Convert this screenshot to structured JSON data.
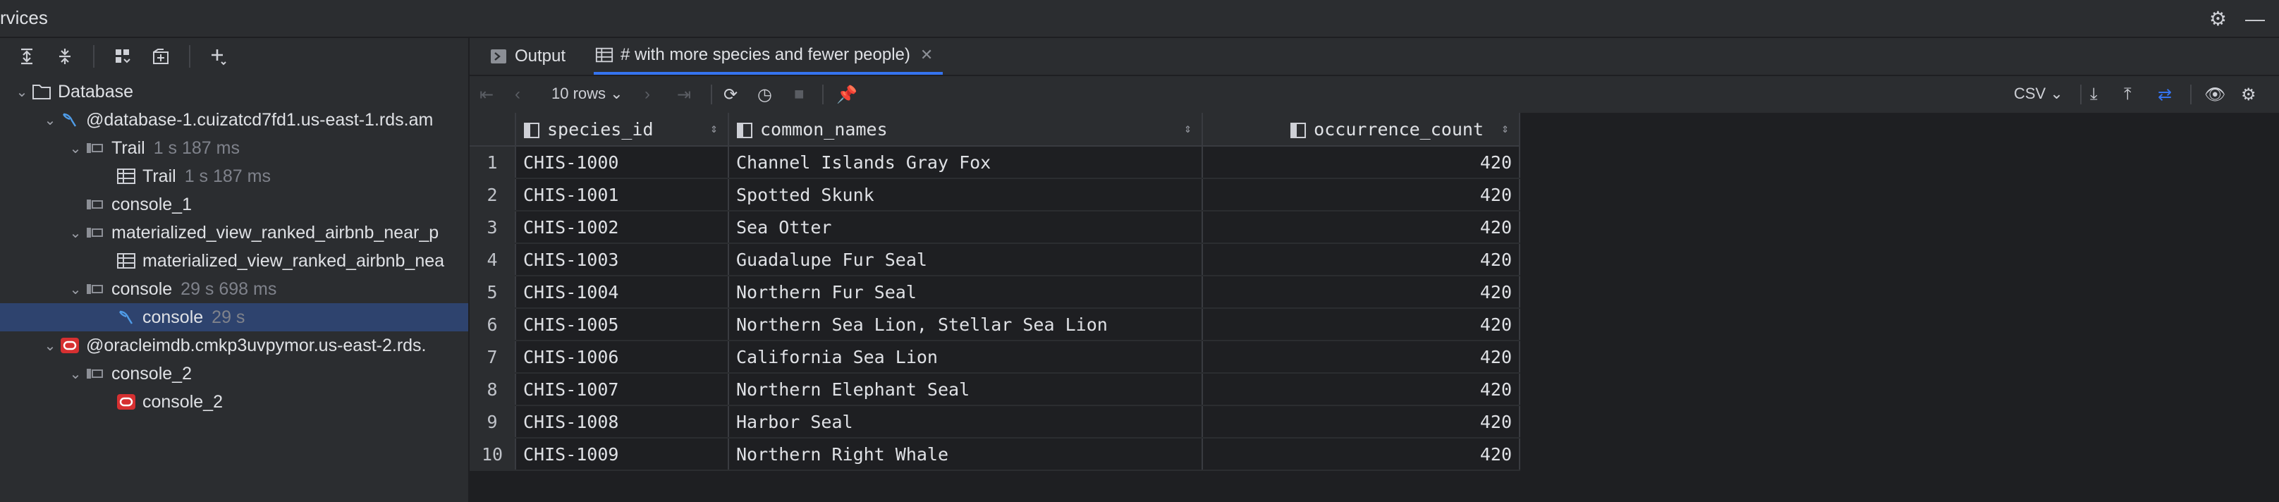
{
  "panel": {
    "title": "rvices"
  },
  "tree": [
    {
      "label": "Database",
      "meta": ""
    },
    {
      "label": "@database-1.cuizatcd7fd1.us-east-1.rds.am",
      "meta": ""
    },
    {
      "label": "Trail",
      "meta": "1 s 187 ms"
    },
    {
      "label": "Trail",
      "meta": "1 s 187 ms"
    },
    {
      "label": "console_1",
      "meta": ""
    },
    {
      "label": "materialized_view_ranked_airbnb_near_p",
      "meta": ""
    },
    {
      "label": "materialized_view_ranked_airbnb_nea",
      "meta": ""
    },
    {
      "label": "console",
      "meta": "29 s 698 ms"
    },
    {
      "label": "console",
      "meta": "29 s"
    },
    {
      "label": "@oracleimdb.cmkp3uvpymor.us-east-2.rds.",
      "meta": ""
    },
    {
      "label": "console_2",
      "meta": ""
    },
    {
      "label": "console_2",
      "meta": ""
    }
  ],
  "tabs": {
    "output": "Output",
    "result": "# with more species and fewer people)"
  },
  "toolbar": {
    "rows": "10 rows",
    "format": "CSV"
  },
  "grid": {
    "columns": [
      "species_id",
      "common_names",
      "occurrence_count"
    ],
    "rows": [
      [
        "1",
        "CHIS-1000",
        "Channel Islands Gray Fox",
        "420"
      ],
      [
        "2",
        "CHIS-1001",
        "Spotted Skunk",
        "420"
      ],
      [
        "3",
        "CHIS-1002",
        "Sea Otter",
        "420"
      ],
      [
        "4",
        "CHIS-1003",
        "Guadalupe Fur Seal",
        "420"
      ],
      [
        "5",
        "CHIS-1004",
        "Northern Fur Seal",
        "420"
      ],
      [
        "6",
        "CHIS-1005",
        "Northern Sea Lion, Stellar Sea Lion",
        "420"
      ],
      [
        "7",
        "CHIS-1006",
        "California Sea Lion",
        "420"
      ],
      [
        "8",
        "CHIS-1007",
        "Northern Elephant Seal",
        "420"
      ],
      [
        "9",
        "CHIS-1008",
        "Harbor Seal",
        "420"
      ],
      [
        "10",
        "CHIS-1009",
        "Northern Right Whale",
        "420"
      ]
    ]
  },
  "colors": {
    "accent": "#3574f0",
    "selected": "#2e436e",
    "oracle": "#d63031"
  }
}
